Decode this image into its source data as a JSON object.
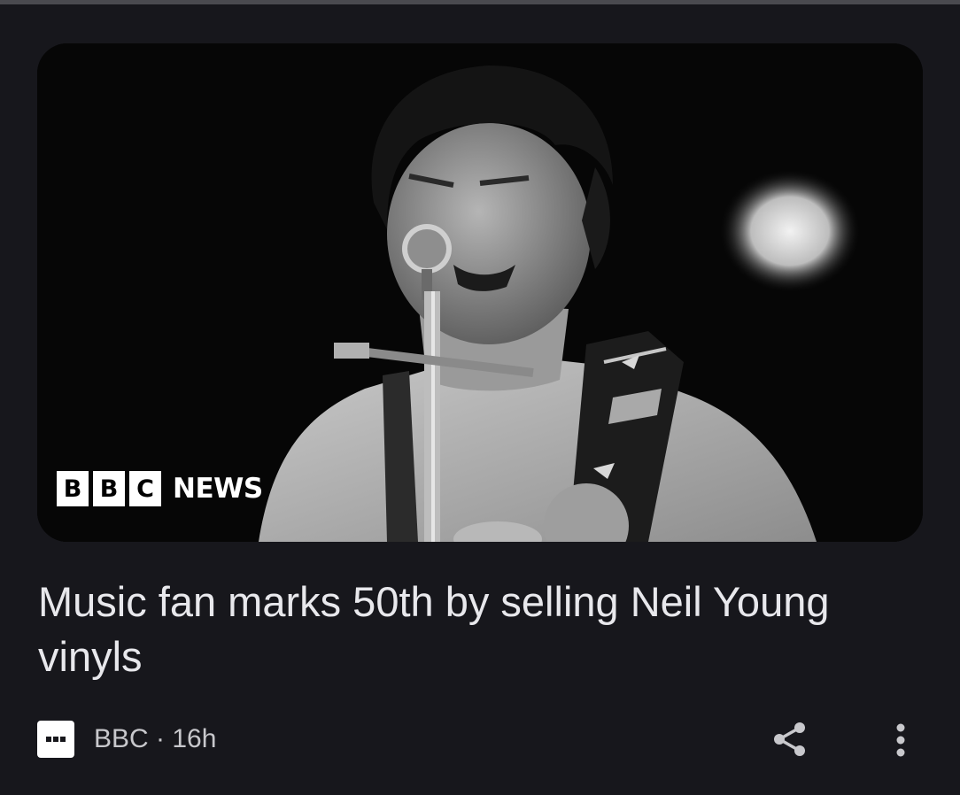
{
  "article": {
    "headline": "Music fan marks 50th by selling Neil Young vinyls",
    "image_alt": "Black and white photo of a musician singing into a microphone with a guitar strap",
    "image_badge": {
      "blocks": [
        "B",
        "B",
        "C"
      ],
      "word": "NEWS"
    },
    "source": "BBC",
    "separator": " · ",
    "age": "16h"
  },
  "actions": {
    "share": "share-icon",
    "more": "more-vert-icon"
  },
  "colors": {
    "background": "#17171c",
    "headline": "#e8e8ec",
    "meta_text": "#c8c8cc",
    "icon": "#c8c8cc"
  }
}
